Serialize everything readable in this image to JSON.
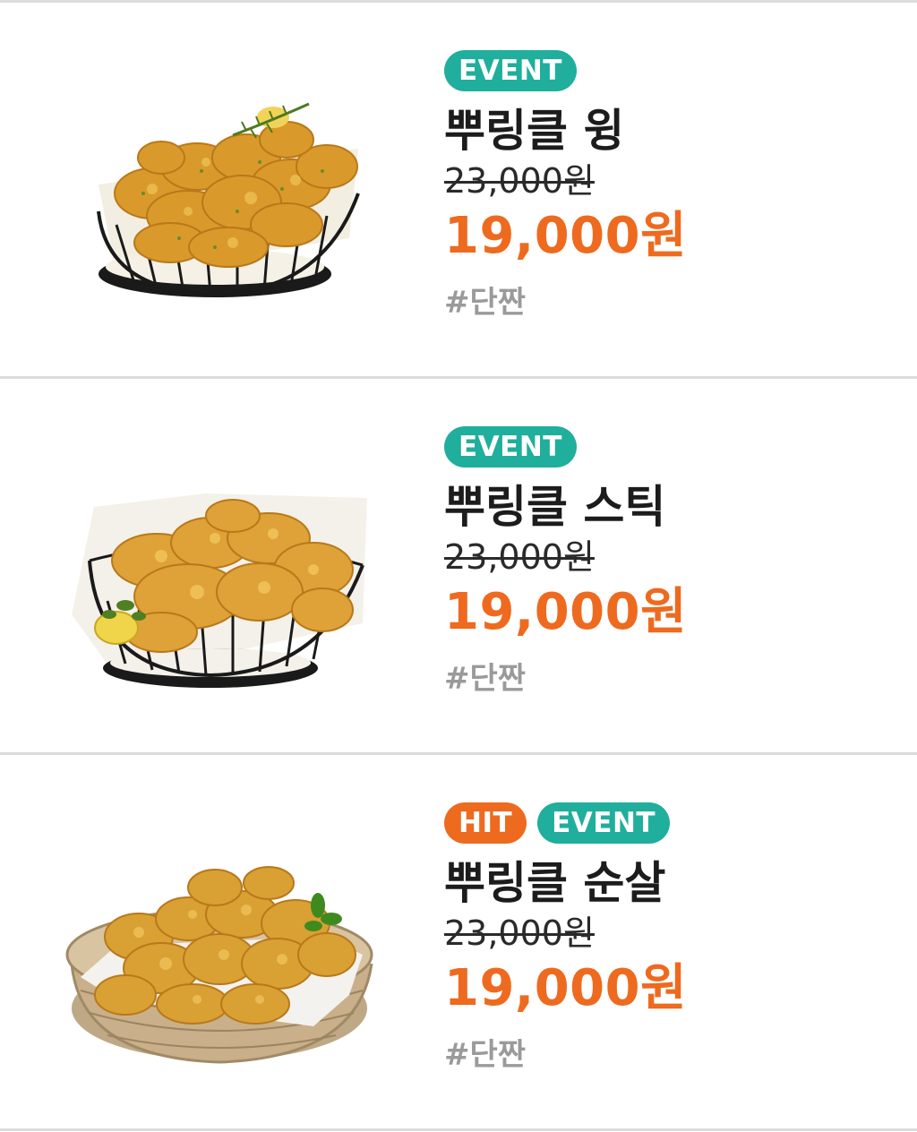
{
  "items": [
    {
      "badges": [
        {
          "label": "EVENT",
          "kind": "event"
        }
      ],
      "name": "뿌링클 윙",
      "original_price": "23,000원",
      "sale_price": "19,000원",
      "tag": "#단짠",
      "image": "fried-chicken-wings-in-wire-basket"
    },
    {
      "badges": [
        {
          "label": "EVENT",
          "kind": "event"
        }
      ],
      "name": "뿌링클 스틱",
      "original_price": "23,000원",
      "sale_price": "19,000원",
      "tag": "#단짠",
      "image": "fried-chicken-drumsticks-in-wire-basket"
    },
    {
      "badges": [
        {
          "label": "HIT",
          "kind": "hit"
        },
        {
          "label": "EVENT",
          "kind": "event"
        }
      ],
      "name": "뿌링클 순살",
      "original_price": "23,000원",
      "sale_price": "19,000원",
      "tag": "#단짠",
      "image": "boneless-fried-chicken-in-wicker-basket"
    }
  ],
  "colors": {
    "event_badge": "#20ae9d",
    "hit_badge": "#ee6a1f",
    "sale_price": "#ee6a1f",
    "tag": "#9a9a9a",
    "divider": "#dcdcdc"
  }
}
